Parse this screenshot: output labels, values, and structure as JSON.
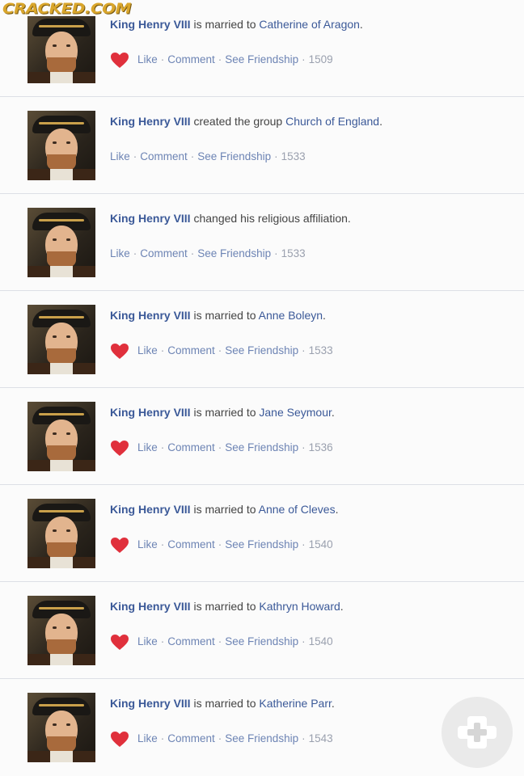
{
  "watermark": "CRACKED.COM",
  "colors": {
    "link": "#3b5998",
    "heart": "#e0303c",
    "meta": "#9aa0ae"
  },
  "feed": [
    {
      "actor": "King Henry VIII",
      "verb": "is married to",
      "target": "Catherine of Aragon",
      "end": ".",
      "heart": true,
      "actions": {
        "like": "Like",
        "comment": "Comment",
        "see_friendship": "See Friendship"
      },
      "year": "1509"
    },
    {
      "actor": "King Henry VIII",
      "verb": "created the group",
      "target": "Church of England",
      "end": ".",
      "heart": false,
      "actions": {
        "like": "Like",
        "comment": "Comment",
        "see_friendship": "See Friendship"
      },
      "year": "1533"
    },
    {
      "actor": "King Henry VIII",
      "verb": "changed his religious affiliation.",
      "target": "",
      "end": "",
      "heart": false,
      "actions": {
        "like": "Like",
        "comment": "Comment",
        "see_friendship": "See Friendship"
      },
      "year": "1533"
    },
    {
      "actor": "King Henry VIII",
      "verb": "is married to",
      "target": "Anne Boleyn",
      "end": ".",
      "heart": true,
      "actions": {
        "like": "Like",
        "comment": "Comment",
        "see_friendship": "See Friendship"
      },
      "year": "1533"
    },
    {
      "actor": "King Henry VIII",
      "verb": "is married to",
      "target": "Jane Seymour",
      "end": ".",
      "heart": true,
      "actions": {
        "like": "Like",
        "comment": "Comment",
        "see_friendship": "See Friendship"
      },
      "year": "1536"
    },
    {
      "actor": "King Henry VIII",
      "verb": "is married to",
      "target": "Anne of Cleves",
      "end": ".",
      "heart": true,
      "actions": {
        "like": "Like",
        "comment": "Comment",
        "see_friendship": "See Friendship"
      },
      "year": "1540"
    },
    {
      "actor": "King Henry VIII",
      "verb": "is married to",
      "target": "Kathryn Howard",
      "end": ".",
      "heart": true,
      "actions": {
        "like": "Like",
        "comment": "Comment",
        "see_friendship": "See Friendship"
      },
      "year": "1540"
    },
    {
      "actor": "King Henry VIII",
      "verb": "is married to",
      "target": "Katherine Parr",
      "end": ".",
      "heart": true,
      "actions": {
        "like": "Like",
        "comment": "Comment",
        "see_friendship": "See Friendship"
      },
      "year": "1543"
    }
  ],
  "icons": {
    "heart": "heart-icon",
    "fab": "plus-icon"
  }
}
